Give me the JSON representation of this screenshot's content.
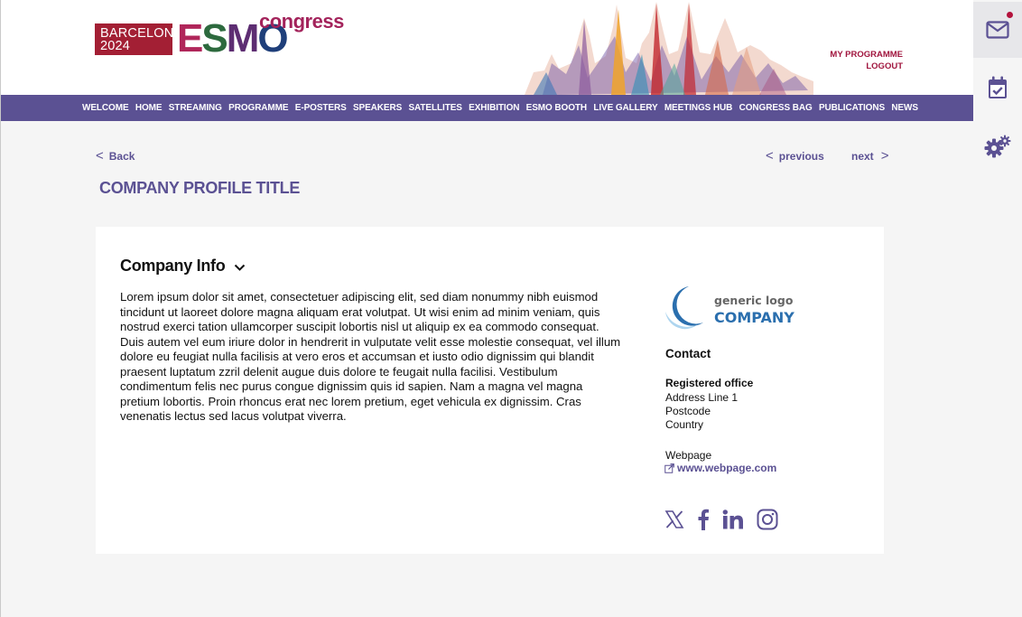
{
  "brand": {
    "city": "BARCELONA",
    "year": "2024",
    "esmo_letters": [
      "E",
      "S",
      "M",
      "O"
    ],
    "congress": "congress"
  },
  "user_links": {
    "programme": "MY PROGRAMME",
    "logout": "LOGOUT"
  },
  "nav": [
    "WELCOME",
    "HOME",
    "STREAMING",
    "PROGRAMME",
    "E-POSTERS",
    "SPEAKERS",
    "SATELLITES",
    "EXHIBITION",
    "ESMO BOOTH",
    "LIVE GALLERY",
    "MEETINGS HUB",
    "CONGRESS BAG",
    "PUBLICATIONS",
    "NEWS"
  ],
  "pager": {
    "back": "Back",
    "previous": "previous",
    "next": "next"
  },
  "page_title": "COMPANY PROFILE TITLE",
  "company_info": {
    "heading": "Company Info",
    "description": "Lorem ipsum dolor sit amet, consectetuer adipiscing elit, sed diam nonummy nibh euismod tincidunt ut laoreet dolore magna aliquam erat volutpat. Ut wisi enim ad minim veniam, quis nostrud exerci tation ullamcorper suscipit lobortis nisl ut aliquip ex ea commodo consequat. Duis autem vel eum iriure dolor in hendrerit in vulputate velit esse molestie consequat, vel illum dolore eu feugiat nulla facilisis at vero eros et accumsan et iusto odio dignissim qui blandit praesent luptatum zzril delenit augue duis dolore te feugait nulla facilisi. Vestibulum condimentum felis nec purus congue dignissim quis id sapien. Nam a magna vel magna pretium lobortis. Proin rhoncus erat nec lorem pretium, eget vehicula ex dignissim. Cras venenatis lectus sed lacus volutpat viverra."
  },
  "company_logo": {
    "line1": "generic logo",
    "line2": "COMPANY"
  },
  "contact": {
    "title": "Contact",
    "office_title": "Registered office",
    "address": [
      "Address Line 1",
      "Postcode",
      "Country"
    ],
    "webpage_label": "Webpage",
    "webpage_url": "www.webpage.com"
  },
  "social_icons": [
    "x-icon",
    "facebook-icon",
    "linkedin-icon",
    "instagram-icon"
  ],
  "rail_icons": [
    "mail-icon",
    "calendar-check-icon",
    "settings-gears-icon"
  ],
  "colors": {
    "accent": "#5b5193",
    "brand_red": "#a31f34",
    "link_red": "#a0153e",
    "notification": "#b3123c"
  }
}
